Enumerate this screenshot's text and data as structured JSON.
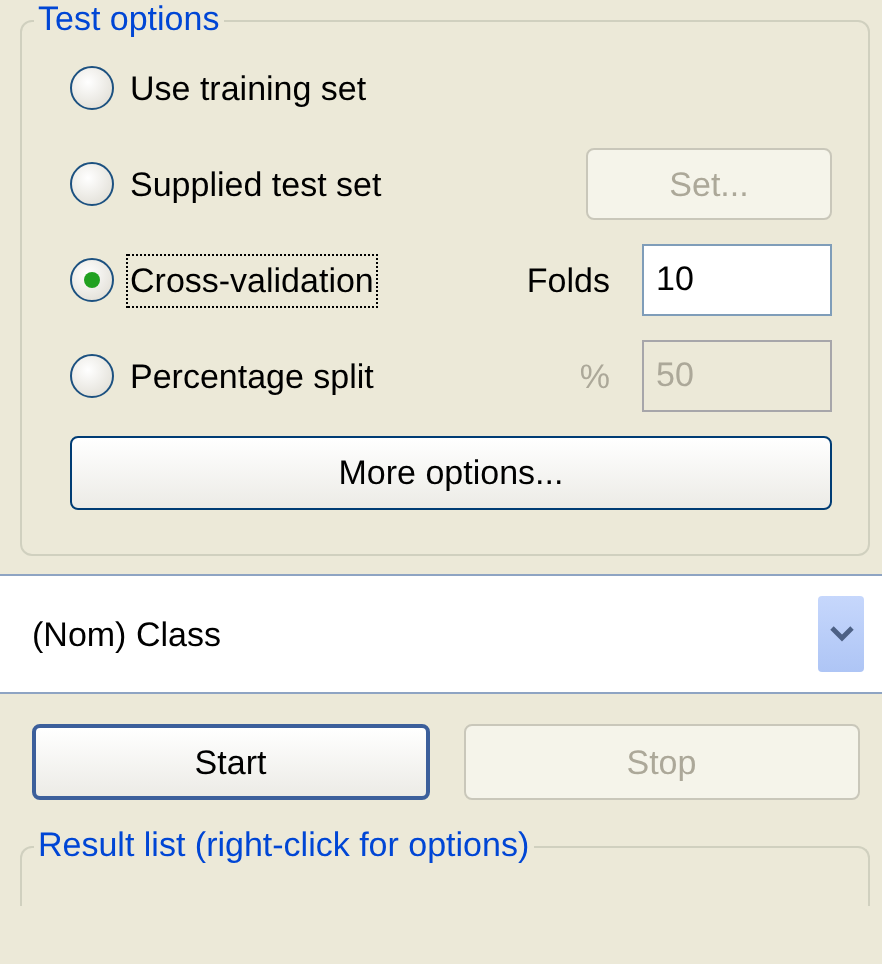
{
  "test_options": {
    "title": "Test options",
    "options": [
      {
        "label": "Use training set",
        "selected": false,
        "focused": false
      },
      {
        "label": "Supplied test set",
        "selected": false,
        "focused": false,
        "control": {
          "kind": "button",
          "label": "Set...",
          "disabled": true
        }
      },
      {
        "label": "Cross-validation",
        "selected": true,
        "focused": true,
        "control": {
          "kind": "field",
          "label": "Folds",
          "value": "10",
          "disabled": false
        }
      },
      {
        "label": "Percentage split",
        "selected": false,
        "focused": false,
        "control": {
          "kind": "field",
          "label": "%",
          "value": "50",
          "disabled": true
        }
      }
    ],
    "more_button": {
      "label": "More options...",
      "disabled": false
    }
  },
  "class_select": {
    "value": "(Nom) Class"
  },
  "buttons": [
    {
      "label": "Start",
      "disabled": false,
      "default": true
    },
    {
      "label": "Stop",
      "disabled": true,
      "default": false
    }
  ],
  "result_list": {
    "title": "Result list (right-click for options)"
  }
}
